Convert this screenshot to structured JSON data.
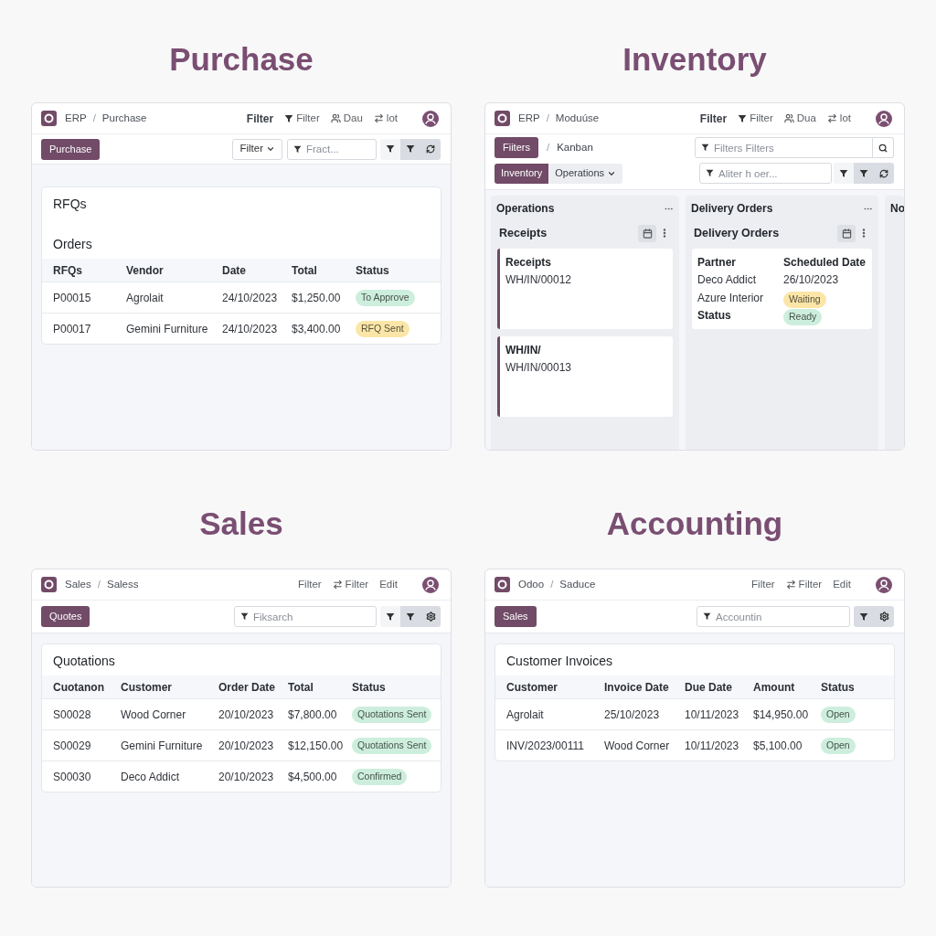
{
  "panels": [
    {
      "kind": "list",
      "title": "Purchase",
      "breadcrumb": [
        "ERP",
        "Purchase"
      ],
      "separator": "/",
      "menu": [
        {
          "kind": "strong",
          "label": "Filter"
        },
        {
          "kind": "filter",
          "label": "Filter"
        },
        {
          "kind": "group",
          "label": "Dau"
        },
        {
          "kind": "swap",
          "label": "lot"
        }
      ],
      "primary_button": "Purchase",
      "dropdown_button": "Filter",
      "search": {
        "placeholder": "Fract..."
      },
      "tool_buttons": [
        {
          "kind": "filter",
          "selected": false
        },
        {
          "kind": "filter",
          "selected": true
        },
        {
          "kind": "refresh",
          "selected": true
        }
      ],
      "card": {
        "headings": [
          "RFQs",
          "Orders"
        ],
        "columns": [
          "RFQs",
          "Vendor",
          "Date",
          "Total",
          "Status"
        ],
        "rows": [
          {
            "cells": [
              "P00015",
              "Agrolait",
              "24/10/2023",
              "$1,250.00"
            ],
            "status": {
              "label": "To Approve",
              "color": "#cdeedd"
            }
          },
          {
            "cells": [
              "P00017",
              "Gemini Furniture",
              "24/10/2023",
              "$3,400.00"
            ],
            "status": {
              "label": "RFQ Sent",
              "color": "#fbe6a8"
            }
          }
        ]
      }
    },
    {
      "kind": "kanban",
      "title": "Inventory",
      "breadcrumb": [
        "ERP",
        "Moduúse"
      ],
      "separator": "/",
      "menu": [
        {
          "kind": "strong",
          "label": "Filter"
        },
        {
          "kind": "filter",
          "label": "Filter"
        },
        {
          "kind": "group",
          "label": "Dua"
        },
        {
          "kind": "swap",
          "label": "lot"
        }
      ],
      "primary_button": "Fiiters",
      "view_separator": "/",
      "view_label": "Kanban",
      "search": {
        "placeholder": "Filters Filters"
      },
      "tabs": [
        {
          "label": "Inventory",
          "selected": true,
          "has_menu": false
        },
        {
          "label": "Operations",
          "selected": false,
          "has_menu": true
        }
      ],
      "search_2": {
        "placeholder": "Aliter h oer..."
      },
      "tool_buttons": [
        {
          "kind": "filter",
          "selected": false
        },
        {
          "kind": "filter",
          "selected": true
        },
        {
          "kind": "refresh",
          "selected": true
        }
      ],
      "columns": [
        {
          "title": "Operations",
          "subtitle": "Receipts",
          "cards": [
            {
              "kind": "record",
              "title": "Receipts",
              "reference": "WH/IN/00012"
            },
            {
              "kind": "record",
              "title": "WH/IN/",
              "reference": "WH/IN/00013"
            }
          ]
        },
        {
          "title": "Delivery Orders",
          "subtitle": "Delivery Orders",
          "cards": [
            {
              "kind": "details",
              "rows": [
                [
                  {
                    "kind": "label",
                    "text": "Partner"
                  },
                  {
                    "kind": "label",
                    "text": "Scheduled Date"
                  }
                ],
                [
                  {
                    "kind": "text",
                    "text": "Deco Addict"
                  },
                  {
                    "kind": "text",
                    "text": "26/10/2023"
                  }
                ],
                [
                  {
                    "kind": "text",
                    "text": "Azure Interior"
                  },
                  {
                    "kind": "badge",
                    "text": "Waiting",
                    "color": "#fbe6a8"
                  }
                ],
                [
                  {
                    "kind": "label",
                    "text": "Status"
                  },
                  {
                    "kind": "badge",
                    "text": "Ready",
                    "color": "#cdeedd"
                  }
                ]
              ]
            }
          ]
        },
        {
          "title": "No"
        }
      ]
    },
    {
      "kind": "list",
      "title": "Sales",
      "breadcrumb": [
        "Sales",
        "Saless"
      ],
      "separator": "/",
      "menu": [
        {
          "kind": "plain",
          "label": "Filter"
        },
        {
          "kind": "swap",
          "label": "Filter"
        },
        {
          "kind": "plain",
          "label": "Edit"
        }
      ],
      "primary_button": "Quotes",
      "search": {
        "placeholder": "Fiksarch"
      },
      "tool_buttons": [
        {
          "kind": "filter",
          "selected": false
        },
        {
          "kind": "filter",
          "selected": true
        },
        {
          "kind": "settings",
          "selected": true
        }
      ],
      "card": {
        "headings": [
          "Quotations"
        ],
        "columns": [
          "Cuotanon",
          "Customer",
          "Order Date",
          "Total",
          "Status"
        ],
        "rows": [
          {
            "cells": [
              "S00028",
              "Wood Corner",
              "20/10/2023",
              "$7,800.00"
            ],
            "status": {
              "label": "Quotations Sent",
              "color": "#cdeedd"
            }
          },
          {
            "cells": [
              "S00029",
              "Gemini Furniture",
              "20/10/2023",
              "$12,150.00"
            ],
            "status": {
              "label": "Quotations Sent",
              "color": "#cdeedd"
            }
          },
          {
            "cells": [
              "S00030",
              "Deco Addict",
              "20/10/2023",
              "$4,500.00"
            ],
            "status": {
              "label": "Confirmed",
              "color": "#cdeedd"
            }
          }
        ]
      }
    },
    {
      "kind": "list",
      "title": "Accounting",
      "breadcrumb": [
        "Odoo",
        "Saduce"
      ],
      "separator": "/",
      "menu": [
        {
          "kind": "plain",
          "label": "Filter"
        },
        {
          "kind": "swap",
          "label": "Filter"
        },
        {
          "kind": "plain",
          "label": "Edit"
        }
      ],
      "primary_button": "Sales",
      "search": {
        "placeholder": "Accountin"
      },
      "tool_buttons": [
        {
          "kind": "filter",
          "selected": true
        },
        {
          "kind": "settings",
          "selected": true
        }
      ],
      "card": {
        "headings": [
          "Customer Invoices"
        ],
        "columns": [
          "Customer",
          "Invoice Date",
          "Due Date",
          "Amount",
          "Status"
        ],
        "rows": [
          {
            "cells": [
              "Agrolait",
              "25/10/2023",
              "10/11/2023",
              "$14,950.00"
            ],
            "status": {
              "label": "Open",
              "color": "#cdeedd"
            }
          },
          {
            "cells": [
              "INV/2023/00111",
              "Wood Corner",
              "10/11/2023",
              "$5,100.00"
            ],
            "status": {
              "label": "Open",
              "color": "#cdeedd"
            }
          }
        ]
      }
    }
  ]
}
